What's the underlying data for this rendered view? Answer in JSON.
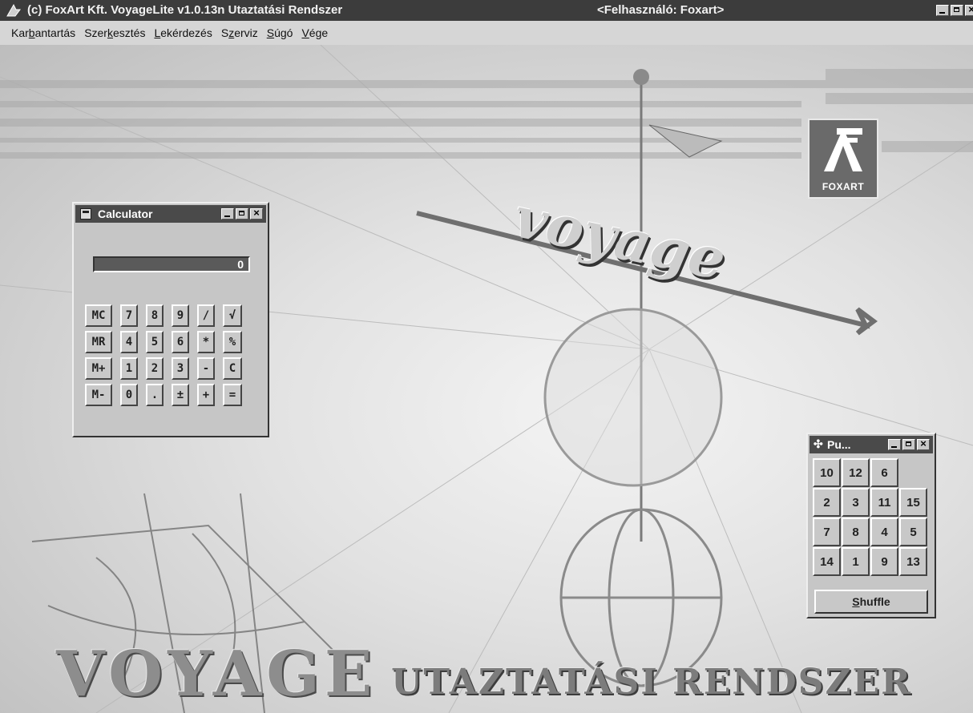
{
  "titlebar": {
    "title": "(c) FoxArt Kft. VoyageLite v1.0.13n Utaztatási Rendszer",
    "user": "<Felhasználó: Foxart>"
  },
  "menu": {
    "items": [
      {
        "label": "Karbantartás",
        "accel": "b"
      },
      {
        "label": "Szerkesztés",
        "accel": "k"
      },
      {
        "label": "Lekérdezés",
        "accel": "L"
      },
      {
        "label": "Szerviz",
        "accel": "z"
      },
      {
        "label": "Súgó",
        "accel": "S"
      },
      {
        "label": "Vége",
        "accel": "V"
      }
    ]
  },
  "background": {
    "logo_text": "FOXART",
    "banner_word": "voyage",
    "big_word": "VOYAGE",
    "big_subtitle": "UTAZTATÁSI RENDSZER"
  },
  "calculator": {
    "title": "Calculator",
    "display": "0",
    "keys": [
      "MC",
      "7",
      "8",
      "9",
      "/",
      "√",
      "MR",
      "4",
      "5",
      "6",
      "*",
      "%",
      "M+",
      "1",
      "2",
      "3",
      "-",
      "C",
      "M-",
      "0",
      ".",
      "±",
      "+",
      "="
    ]
  },
  "puzzle": {
    "title": "Pu...",
    "tiles": [
      "10",
      "12",
      "6",
      "",
      "2",
      "3",
      "11",
      "15",
      "7",
      "8",
      "4",
      "5",
      "14",
      "1",
      "9",
      "13"
    ],
    "shuffle_label": "Shuffle"
  },
  "colors": {
    "titlebar_bg": "#3c3c3c",
    "window_face": "#c6c6c6",
    "display_bg": "#5a5a5a"
  }
}
